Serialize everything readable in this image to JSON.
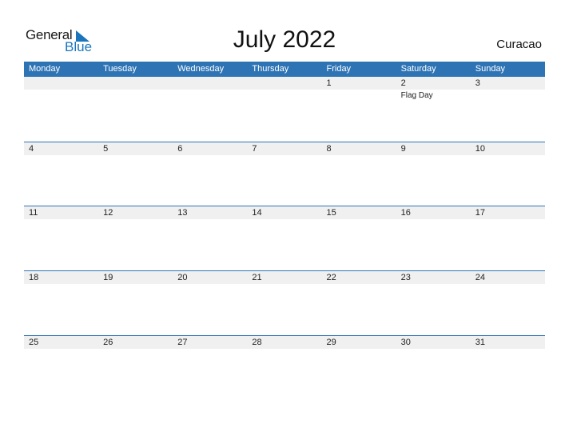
{
  "logo": {
    "general": "General",
    "blue": "Blue"
  },
  "title": "July 2022",
  "country": "Curacao",
  "colors": {
    "accent": "#2e74b5",
    "row_bg": "#f0f0f0",
    "logo_blue": "#1b75bc"
  },
  "weekdays": [
    "Monday",
    "Tuesday",
    "Wednesday",
    "Thursday",
    "Friday",
    "Saturday",
    "Sunday"
  ],
  "weeks": [
    {
      "days": [
        "",
        "",
        "",
        "",
        "1",
        "2",
        "3"
      ],
      "events": [
        "",
        "",
        "",
        "",
        "",
        "Flag Day",
        ""
      ]
    },
    {
      "days": [
        "4",
        "5",
        "6",
        "7",
        "8",
        "9",
        "10"
      ],
      "events": [
        "",
        "",
        "",
        "",
        "",
        "",
        ""
      ]
    },
    {
      "days": [
        "11",
        "12",
        "13",
        "14",
        "15",
        "16",
        "17"
      ],
      "events": [
        "",
        "",
        "",
        "",
        "",
        "",
        ""
      ]
    },
    {
      "days": [
        "18",
        "19",
        "20",
        "21",
        "22",
        "23",
        "24"
      ],
      "events": [
        "",
        "",
        "",
        "",
        "",
        "",
        ""
      ]
    },
    {
      "days": [
        "25",
        "26",
        "27",
        "28",
        "29",
        "30",
        "31"
      ],
      "events": [
        "",
        "",
        "",
        "",
        "",
        "",
        ""
      ]
    }
  ]
}
